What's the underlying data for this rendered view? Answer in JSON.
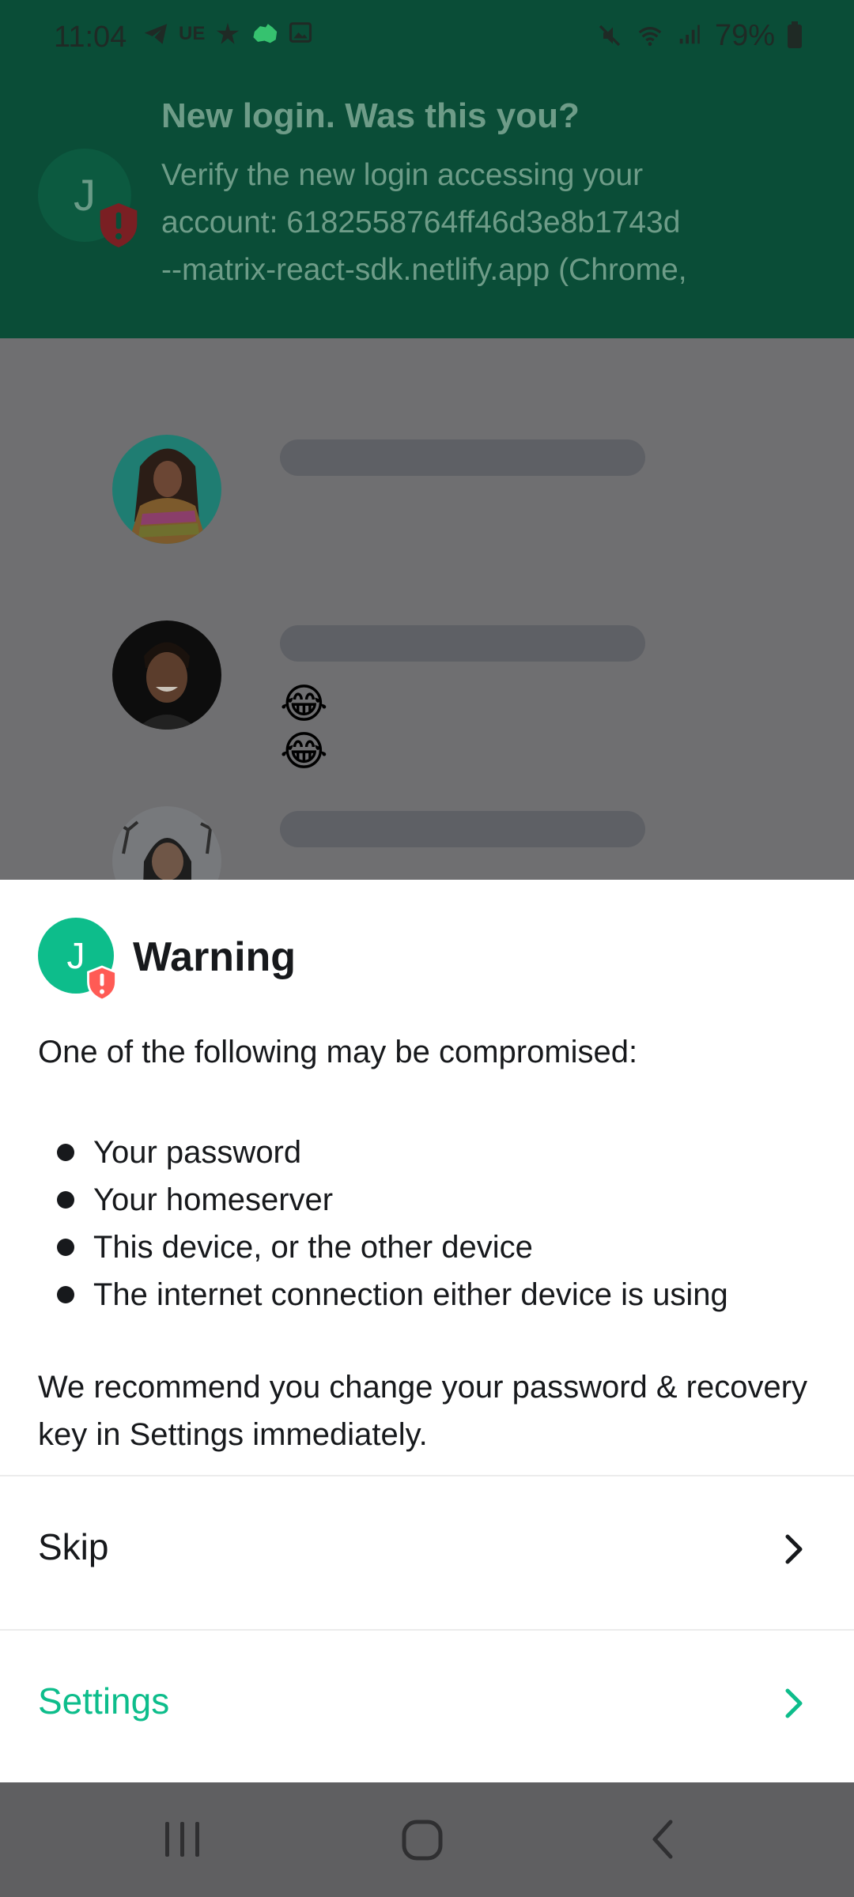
{
  "status_bar": {
    "time": "11:04",
    "left_icons": [
      "telegram-icon",
      "ue-icon",
      "puzzle-icon",
      "australia-icon",
      "image-icon"
    ],
    "ue_label": "UE",
    "right_icons": [
      "mute-icon",
      "wifi-icon",
      "signal-icon"
    ],
    "battery": "79%"
  },
  "notification": {
    "avatar_letter": "J",
    "title": "New login. Was this you?",
    "body_lines": [
      "Verify the new login accessing your",
      "account: 6182558764ff46d3e8b1743d",
      "--matrix-react-sdk.netlify.app (Chrome,"
    ]
  },
  "timeline": {
    "messages": [
      {
        "emoji": ""
      },
      {
        "emoji": "😂😂"
      },
      {
        "emoji": ""
      }
    ]
  },
  "sheet": {
    "avatar_letter": "J",
    "title": "Warning",
    "intro": "One of the following may be compromised:",
    "bullets": [
      "Your password",
      "Your homeserver",
      "This device, or the other device",
      "The internet connection either device is using"
    ],
    "recommendation": "We recommend you change your password & recovery key in Settings immediately.",
    "actions": {
      "skip_label": "Skip",
      "settings_label": "Settings"
    }
  },
  "colors": {
    "brand_green": "#0dbd8b",
    "header_green": "#0a4d37",
    "alert_red": "#ff5b55"
  }
}
